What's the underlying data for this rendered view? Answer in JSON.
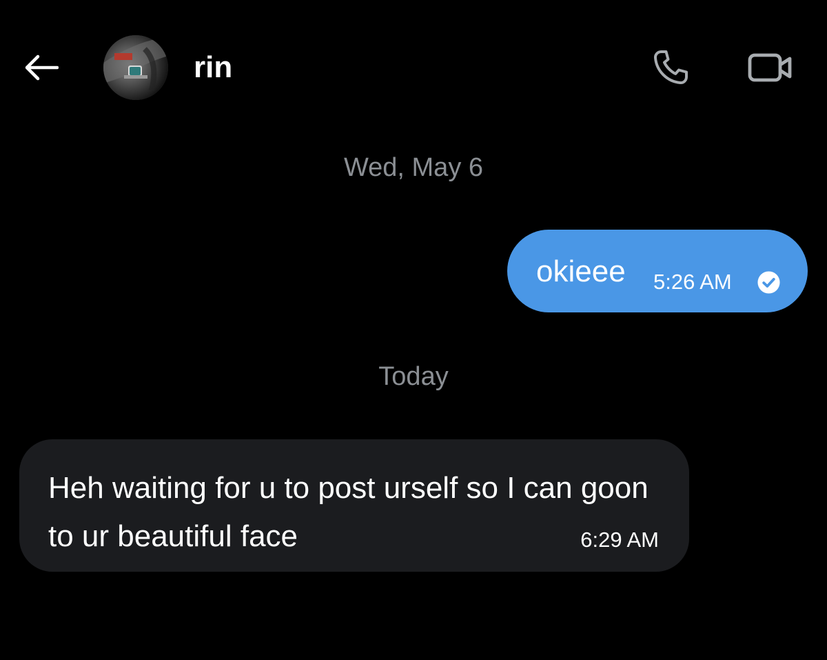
{
  "header": {
    "contact_name": "rin",
    "back_icon": "arrow-left-icon",
    "call_icon": "phone-icon",
    "video_icon": "video-camera-icon"
  },
  "conversation": {
    "sections": [
      {
        "date_label": "Wed, May 6",
        "messages": [
          {
            "direction": "outgoing",
            "text": "okieee",
            "time": "5:26 AM",
            "status_icon": "read-check-icon"
          }
        ]
      },
      {
        "date_label": "Today",
        "messages": [
          {
            "direction": "incoming",
            "text": "Heh waiting for u to post urself so I can goon to ur beautiful face",
            "time": "6:29 AM"
          }
        ]
      }
    ]
  },
  "colors": {
    "background": "#000000",
    "outgoing_bubble": "#4a97e6",
    "incoming_bubble": "#1b1c1f",
    "muted_text": "#8b8f94",
    "icon_gray": "#a8acb0"
  }
}
